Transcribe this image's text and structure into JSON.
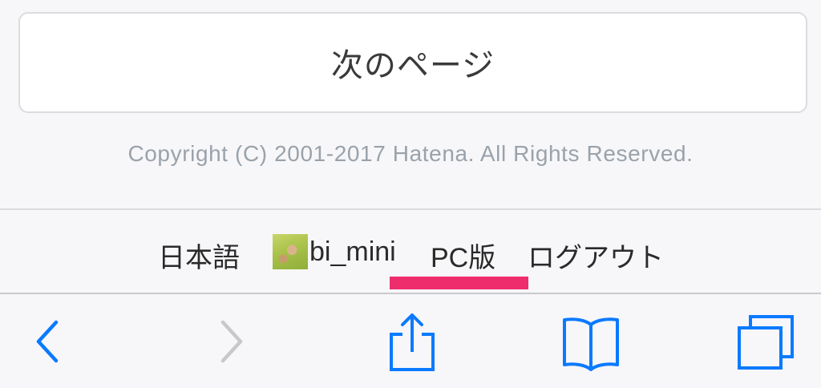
{
  "next_page": {
    "label": "次のページ"
  },
  "copyright": "Copyright (C) 2001-2017 Hatena. All Rights Reserved.",
  "footer": {
    "language": "日本語",
    "username": "bi_mini",
    "pc_version": "PC版",
    "logout": "ログアウト"
  },
  "colors": {
    "accent": "#0a7aff",
    "disabled": "#c7c7cc",
    "highlight": "#ee2d6c",
    "copyright_text": "#9aa2ab"
  },
  "toolbar": {
    "icons": [
      "back-icon",
      "forward-icon",
      "share-icon",
      "bookmarks-icon",
      "tabs-icon"
    ]
  }
}
